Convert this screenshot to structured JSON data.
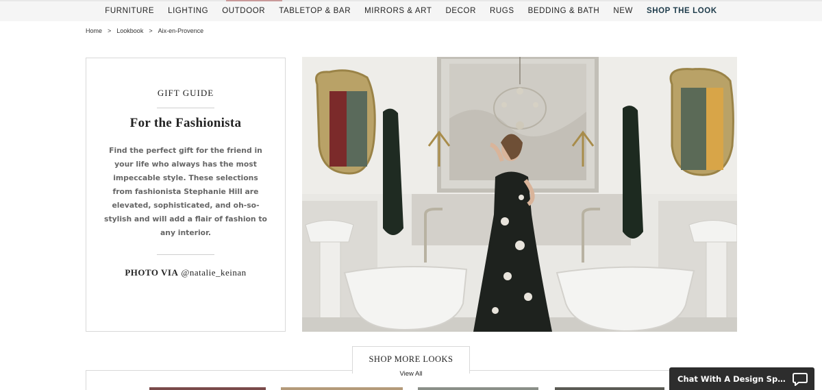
{
  "nav": {
    "items": [
      {
        "label": "FURNITURE"
      },
      {
        "label": "LIGHTING"
      },
      {
        "label": "OUTDOOR"
      },
      {
        "label": "TABLETOP & BAR"
      },
      {
        "label": "MIRRORS & ART"
      },
      {
        "label": "DECOR"
      },
      {
        "label": "RUGS"
      },
      {
        "label": "BEDDING & BATH"
      },
      {
        "label": "NEW"
      },
      {
        "label": "SHOP THE LOOK",
        "active": true
      }
    ]
  },
  "breadcrumb": {
    "items": [
      "Home",
      "Lookbook",
      "Aix-en-Provence"
    ],
    "separator": ">"
  },
  "card": {
    "kicker": "GIFT GUIDE",
    "title": "For the Fashionista",
    "description": "Find the perfect gift for the friend in your life who always has the most impeccable style. These selections from fashionista Stephanie Hill are elevated, sophisticated, and oh-so-stylish and will add a flair of fashion to any interior.",
    "credit_label": "PHOTO VIA",
    "credit_handle": "@natalie_keinan"
  },
  "shop_more": {
    "title": "SHOP MORE LOOKS",
    "view_all": "View All"
  },
  "chat": {
    "label": "Chat With A Design Specialist",
    "icon": "chat-bubble-icon"
  },
  "colors": {
    "nav_active": "#1d3b4a",
    "chat_bg": "#2d2d2d",
    "border": "#d8d8d8"
  }
}
